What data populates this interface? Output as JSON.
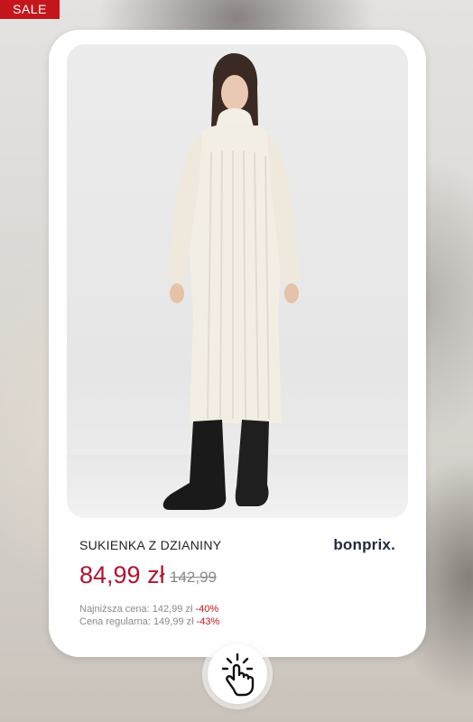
{
  "badge": {
    "label": "SALE"
  },
  "product": {
    "title": "SUKIENKA Z DZIANINY",
    "brand": "bonprix.",
    "price": "84,99 zł",
    "old_price": "142,99",
    "lowest_label": "Najniższa cena: 142,99 zł",
    "lowest_pct": "-40%",
    "regular_label": "Cena regularna: 149,99 zł",
    "regular_pct": "-43%"
  },
  "icons": {
    "tap": "hand-pointer-icon"
  },
  "colors": {
    "accent": "#c4161c",
    "price": "#b0152e"
  }
}
